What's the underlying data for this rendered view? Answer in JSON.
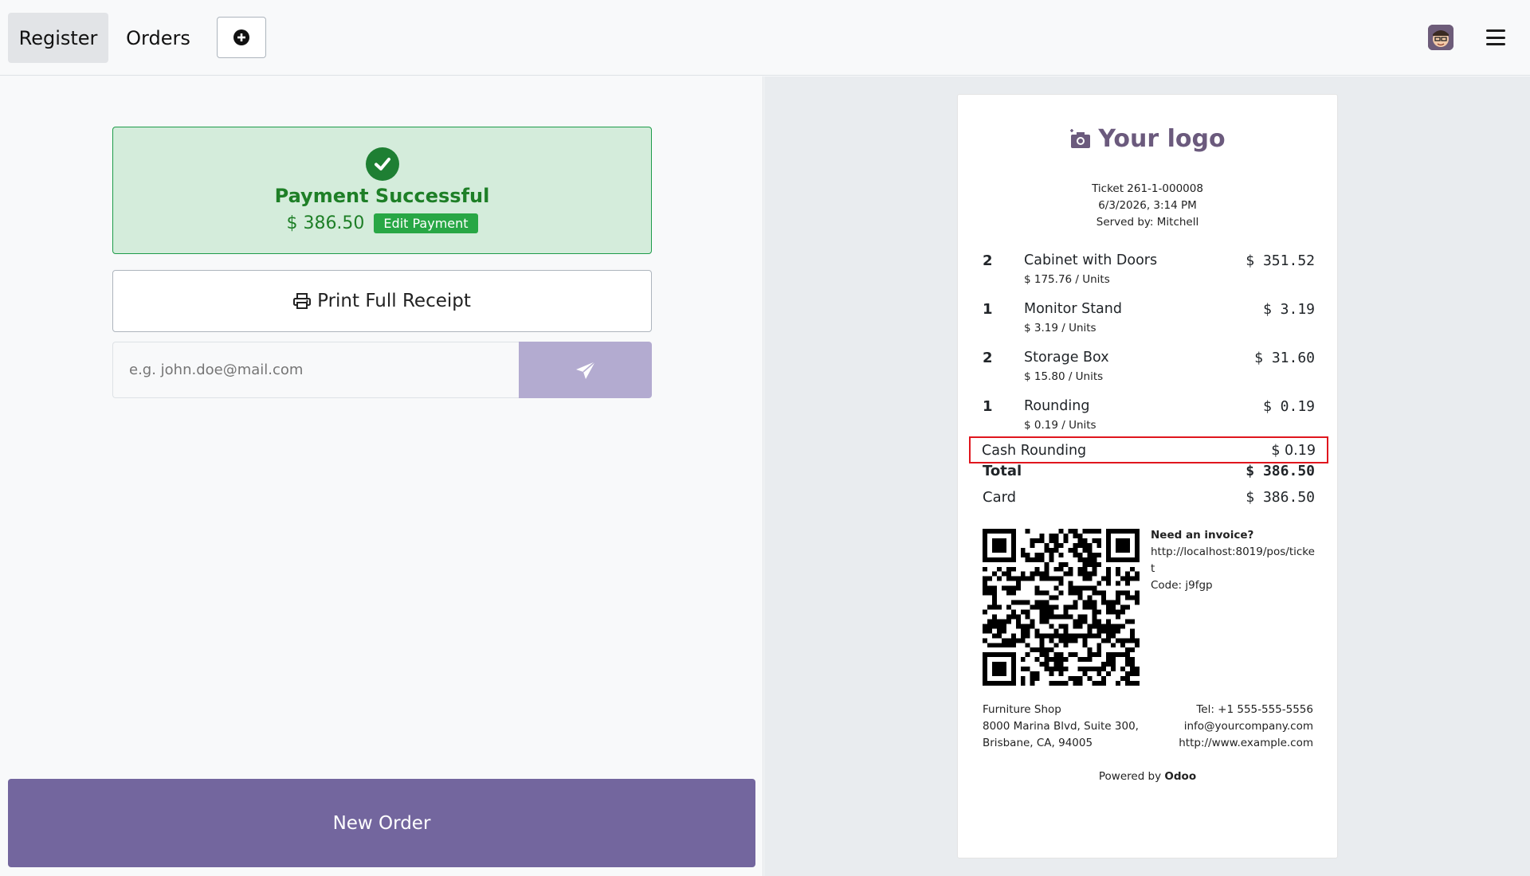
{
  "navbar": {
    "tabs": [
      {
        "label": "Register"
      },
      {
        "label": "Orders"
      }
    ],
    "add_icon": "plus-circle-icon",
    "avatar_icon": "user-avatar",
    "menu_icon": "hamburger-menu-icon"
  },
  "payment": {
    "title": "Payment Successful",
    "amount": "$ 386.50",
    "edit_label": "Edit Payment",
    "status_icon": "check-circle-icon"
  },
  "actions": {
    "print_label": "Print Full Receipt",
    "print_icon": "printer-icon",
    "email_placeholder": "e.g. john.doe@mail.com",
    "send_icon": "paper-plane-icon",
    "new_order_label": "New Order"
  },
  "receipt": {
    "logo_text": "Your logo",
    "logo_icon": "camera-icon",
    "ticket": "Ticket 261-1-000008",
    "datetime": "6/3/2026, 3:14 PM",
    "served_by": "Served by: Mitchell",
    "lines": [
      {
        "qty": "2",
        "name": "Cabinet with Doors",
        "unit": "$ 175.76 / Units",
        "price": "$ 351.52"
      },
      {
        "qty": "1",
        "name": "Monitor Stand",
        "unit": "$ 3.19 / Units",
        "price": "$ 3.19"
      },
      {
        "qty": "2",
        "name": "Storage Box",
        "unit": "$ 15.80 / Units",
        "price": "$ 31.60"
      },
      {
        "qty": "1",
        "name": "Rounding",
        "unit": "$ 0.19 / Units",
        "price": "$ 0.19"
      }
    ],
    "cash_rounding": {
      "label": "Cash Rounding",
      "value": "$ 0.19"
    },
    "total": {
      "label": "Total",
      "value": "$ 386.50"
    },
    "card": {
      "label": "Card",
      "value": "$ 386.50"
    },
    "invoice": {
      "heading": "Need an invoice?",
      "url": "http://localhost:8019/pos/ticket",
      "code": "Code: j9fgp"
    },
    "shop": {
      "name": "Furniture Shop",
      "address1": "8000 Marina Blvd, Suite 300,",
      "address2": "Brisbane, CA, 94005"
    },
    "contact": {
      "tel": "Tel: +1 555-555-5556",
      "email": "info@yourcompany.com",
      "web": "http://www.example.com"
    },
    "powered_prefix": "Powered by",
    "powered_brand": "Odoo"
  },
  "colors": {
    "accent": "#73669e",
    "success": "#1e7f27",
    "success_bg": "#d4ecdb",
    "highlight_border": "#e0161e"
  }
}
